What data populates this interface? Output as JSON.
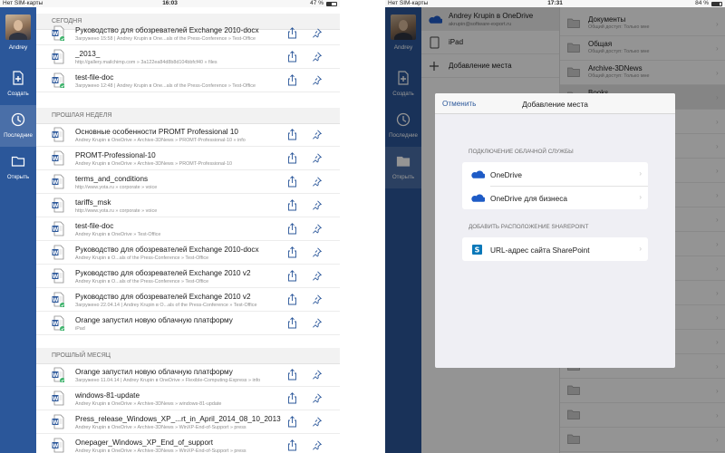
{
  "status_left": {
    "carrier": "Нет SIM-карты",
    "time": "16:03",
    "battery": "47 %",
    "battery_level": 0.47
  },
  "status_right": {
    "carrier": "Нет SIM-карты",
    "time": "17:31",
    "battery": "84 %",
    "battery_level": 0.84
  },
  "colors": {
    "rail": "#2b579a",
    "accent": "#2b579a",
    "onedrive": "#1e5bc6",
    "sharepoint": "#0a78b9",
    "word": "#2b579a",
    "sync": "#3db36b"
  },
  "rail": {
    "user": "Andrey",
    "nav": [
      {
        "label": "Создать",
        "icon": "new-document-icon"
      },
      {
        "label": "Последние",
        "icon": "clock-icon"
      },
      {
        "label": "Открыть",
        "icon": "folder-icon"
      }
    ]
  },
  "recent": {
    "sections": [
      {
        "title": "СЕГОДНЯ"
      },
      {
        "title": "ПРОШЛАЯ НЕДЕЛЯ"
      },
      {
        "title": "ПРОШЛЫЙ МЕСЯЦ"
      }
    ],
    "items": [
      {
        "name": "Руководство для обозревателей Exchange 2010-docx",
        "sub": "Загружено 15:58 | Andrey Krupin в One...als of the Press-Conference » Test-Office"
      },
      {
        "name": "_2013_",
        "sub": "http://gallery.mailchimp.com » 3a122ea84d8b8d104bbfcf40 » files"
      },
      {
        "name": "test-file-doc",
        "sub": "Загружено 12:48 | Andrey Krupin в One...als of the Press-Conference » Test-Office"
      },
      {
        "name": "Основные особенности  PROMT Professional 10",
        "sub": "Andrey Krupin в OneDrive » Archive-3DNews » PROMT-Professional-10 » info"
      },
      {
        "name": "PROMT-Professional-10",
        "sub": "Andrey Krupin в OneDrive » Archive-3DNews » PROMT-Professional-10"
      },
      {
        "name": "terms_and_conditions",
        "sub": "http://www.yota.ru » corporate » voice"
      },
      {
        "name": "tariffs_msk",
        "sub": "http://www.yota.ru » corporate » voice"
      },
      {
        "name": "test-file-doc",
        "sub": "Andrey Krupin в OneDrive » Test-Office"
      },
      {
        "name": "Руководство для обозревателей Exchange 2010-docx",
        "sub": "Andrey Krupin в O...als of the Press-Conference » Test-Office"
      },
      {
        "name": "Руководство для обозревателей Exchange 2010 v2",
        "sub": "Andrey Krupin в O...als of the Press-Conference » Test-Office"
      },
      {
        "name": "Руководство для обозревателей Exchange 2010 v2",
        "sub": "Загружено 22.04.14 | Andrey Krupin в O...als of the Press-Conference » Test-Office"
      },
      {
        "name": "Orange запустил новую облачную платформу",
        "sub": "iPad"
      },
      {
        "name": "Orange запустил новую облачную платформу",
        "sub": "Загружено 11.04.14 | Andrey Krupin в OneDrive » Flexible-Computing-Express » info"
      },
      {
        "name": "windows-81-update",
        "sub": "Andrey Krupin в OneDrive » Archive-3DNews » windows-81-update"
      },
      {
        "name": "Press_release_Windows_XP_...rt_in_April_2014_08_10_2013",
        "sub": "Andrey Krupin в OneDrive » Archive-3DNews » WinXP-End-of-Support » press"
      },
      {
        "name": "Onepager_Windows_XP_End_of_support",
        "sub": "Andrey Krupin в OneDrive » Archive-3DNews » WinXP-End-of-Support » press"
      }
    ]
  },
  "open_panel": {
    "account_name": "Andrey Krupin в OneDrive",
    "account_email": "akrupin@software-export.ru",
    "ipad": "iPad",
    "add_place": "Добавление места",
    "folders": [
      {
        "name": "Документы",
        "sub": "Общий доступ: Только мне"
      },
      {
        "name": "Общая",
        "sub": "Общий доступ: Только мне"
      },
      {
        "name": "Archive-3DNews",
        "sub": "Общий доступ: Только мне"
      },
      {
        "name": "Books",
        "sub": ""
      }
    ]
  },
  "modal": {
    "cancel": "Отменить",
    "title": "Добавление места",
    "cloud_label": "ПОДКЛЮЧЕНИЕ ОБЛАЧНОЙ СЛУЖБЫ",
    "cloud_items": [
      {
        "label": "OneDrive"
      },
      {
        "label": "OneDrive для бизнеса"
      }
    ],
    "sp_label": "ДОБАВИТЬ РАСПОЛОЖЕНИЕ SHAREPOINT",
    "sp_item": "URL-адрес сайта SharePoint"
  }
}
